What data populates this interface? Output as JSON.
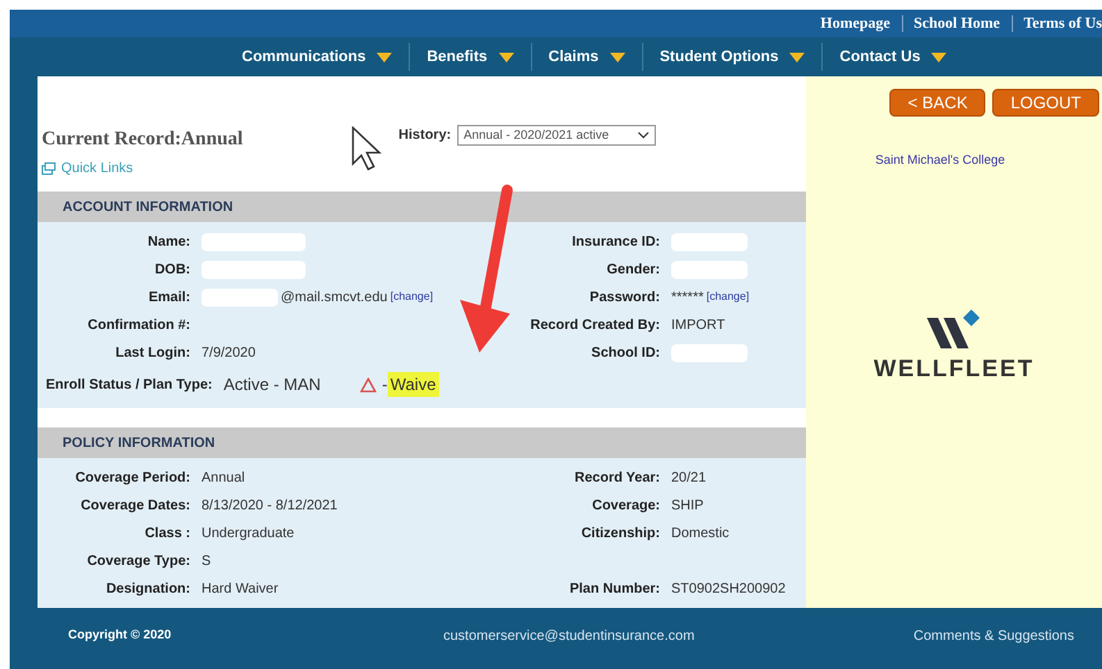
{
  "top_links": [
    "Homepage",
    "School Home",
    "Terms of Us"
  ],
  "nav": [
    "Communications",
    "Benefits",
    "Claims",
    "Student Options",
    "Contact Us"
  ],
  "buttons": [
    "< BACK",
    "LOGOUT"
  ],
  "record_title": "Current Record:Annual",
  "quick_links": "Quick Links",
  "history": {
    "label": "History:",
    "value": "Annual - 2020/2021 active"
  },
  "school": "Saint Michael's College",
  "logo_text": "WELLFLEET",
  "account": {
    "title": "ACCOUNT INFORMATION",
    "rows": [
      [
        {
          "label": "Name:",
          "redacted": true
        },
        {
          "label": "Insurance ID:",
          "redacted": true
        }
      ],
      [
        {
          "label": "DOB:",
          "redacted": true
        },
        {
          "label": "Gender:",
          "redacted": true
        }
      ],
      [
        {
          "label": "Email:",
          "redacted": true,
          "value": "@mail.smcvt.edu",
          "link": "[change]"
        },
        {
          "label": "Password:",
          "value": "******",
          "link": "[change]"
        }
      ],
      [
        {
          "label": "Confirmation #:"
        },
        {
          "label": "Record Created By:",
          "value": "IMPORT"
        }
      ],
      [
        {
          "label": "Last Login:",
          "value": "7/9/2020"
        },
        {
          "label": "School ID:",
          "redacted": true
        }
      ]
    ],
    "enroll": {
      "label": "Enroll Status / Plan Type:",
      "value": "Active - MAN",
      "separator": "-",
      "status": "Waive",
      "highlighted": true
    }
  },
  "policy": {
    "title": "POLICY INFORMATION",
    "rows": [
      [
        {
          "label": "Coverage Period:",
          "value": "Annual"
        },
        {
          "label": "Record Year:",
          "value": "20/21"
        }
      ],
      [
        {
          "label": "Coverage Dates:",
          "value": "8/13/2020 - 8/12/2021"
        },
        {
          "label": "Coverage:",
          "value": "SHIP"
        }
      ],
      [
        {
          "label": "Class :",
          "value": "Undergraduate"
        },
        {
          "label": "Citizenship:",
          "value": "Domestic"
        }
      ],
      [
        {
          "label": "Coverage Type:",
          "value": "S"
        },
        null
      ],
      [
        {
          "label": "Designation:",
          "value": "Hard Waiver"
        },
        {
          "label": "Plan Number:",
          "value": "ST0902SH200902"
        }
      ]
    ]
  },
  "footer": {
    "copyright": "Copyright © 2020",
    "email": "customerservice@studentinsurance.com",
    "comments": "Comments & Suggestions"
  }
}
